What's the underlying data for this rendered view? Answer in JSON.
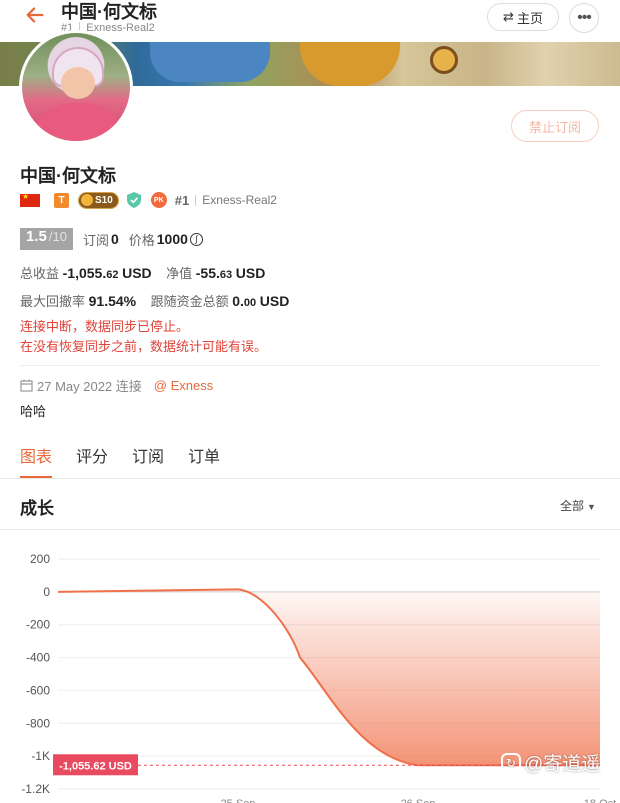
{
  "header": {
    "title": "中国·何文标",
    "rank": "#1",
    "account": "Exness-Real2",
    "home_label": "主页",
    "more_glyph": "•••"
  },
  "profile": {
    "unsubscribe_label": "禁止订阅",
    "name": "中国·何文标",
    "badges": {
      "t_label": "T",
      "s_label": "S10",
      "pk_label": "PK"
    },
    "rank": "#1",
    "account": "Exness-Real2",
    "score": "1.5",
    "score_out": "/10",
    "subscribe_label": "订阅",
    "subscribe_count": "0",
    "price_label": "价格",
    "price_value": "1000",
    "total_profit_label": "总收益",
    "total_profit_value": "-1,055.",
    "total_profit_decimal": "62",
    "total_profit_unit": "USD",
    "equity_label": "净值",
    "equity_value": "-55.",
    "equity_decimal": "63",
    "equity_unit": "USD",
    "drawdown_label": "最大回撤率",
    "drawdown_value": "91.54%",
    "follow_label": "跟随资金总额",
    "follow_value": "0.",
    "follow_decimal": "00",
    "follow_unit": "USD",
    "warning_1": "连接中断，数据同步已停止。",
    "warning_2": "在没有恢复同步之前，数据统计可能有误。",
    "since_text": "27 May 2022 连接",
    "broker": "@ Exness",
    "bio": "哈哈"
  },
  "tabs": [
    {
      "label": "图表",
      "active": true
    },
    {
      "label": "评分",
      "active": false
    },
    {
      "label": "订阅",
      "active": false
    },
    {
      "label": "订单",
      "active": false
    }
  ],
  "section": {
    "title": "成长",
    "range_label": "全部"
  },
  "chart_data": {
    "type": "area",
    "title": "成长",
    "xlabel": "",
    "ylabel": "",
    "ylim": [
      -1200,
      200
    ],
    "yticks": [
      "200",
      "0",
      "-200",
      "-400",
      "-600",
      "-800",
      "-1K",
      "-1.2K"
    ],
    "ytick_values": [
      200,
      0,
      -200,
      -400,
      -600,
      -800,
      -1000,
      -1200
    ],
    "xticks": [
      "25 Sep",
      "26 Sep",
      "18 Oct"
    ],
    "grid": true,
    "series": [
      {
        "color": "#f0704a",
        "points": [
          {
            "x": "start",
            "y": 0
          },
          {
            "x": "25 Sep",
            "y": 15
          },
          {
            "x": "25 Sep +",
            "y": -20
          },
          {
            "x": "mid",
            "y": -400
          },
          {
            "x": "mid2",
            "y": -800
          },
          {
            "x": "26 Sep",
            "y": -1055.62
          },
          {
            "x": "18 Oct",
            "y": -1055.62
          }
        ]
      }
    ],
    "marker_label": "-1,055.62 USD",
    "marker_value": -1055.62
  },
  "watermark": {
    "text": "@寄道遥"
  },
  "colors": {
    "accent": "#e8693a",
    "warning": "#e0433a",
    "marker": "#e84a5f"
  }
}
